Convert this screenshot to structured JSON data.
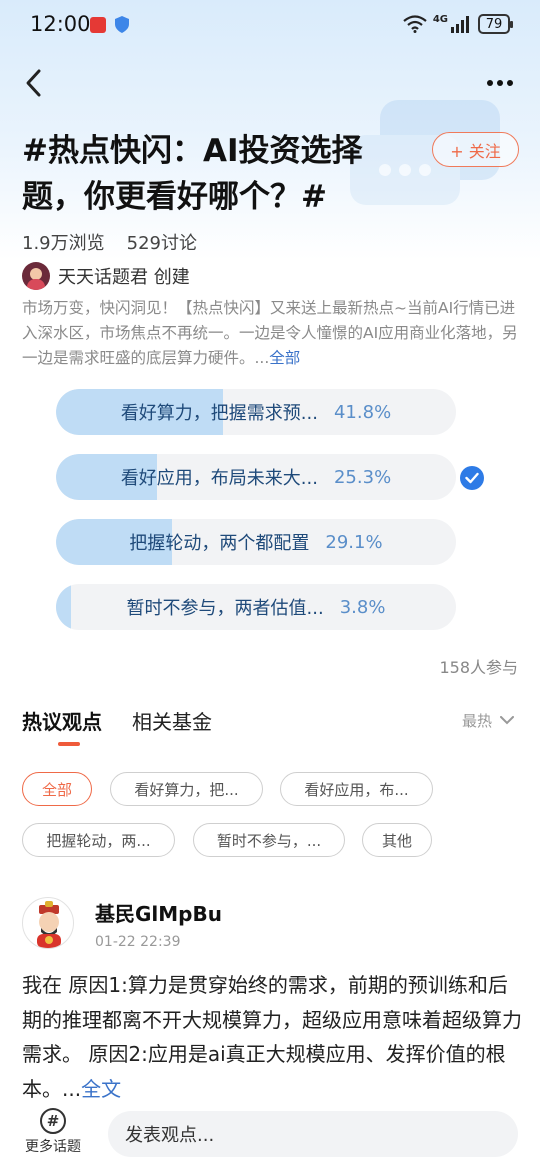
{
  "status_bar": {
    "time": "12:00",
    "network": "4G",
    "battery": "79"
  },
  "topic": {
    "title": "#热点快闪：AI投资选择题，你更看好哪个？#",
    "follow_label": "+ 关注",
    "views": "1.9万浏览",
    "discussions": "529讨论",
    "creator": "天天话题君 创建",
    "description": "市场万变，快闪洞见！【热点快闪】又来送上最新热点~当前AI行情已进入深水区，市场焦点不再统一。一边是令人憧憬的AI应用商业化落地，另一边是需求旺盛的底层算力硬件。...",
    "description_more": "全部"
  },
  "poll": {
    "options": [
      {
        "label": "看好算力，把握需求预...",
        "percent": "41.8%",
        "value": 41.8,
        "selected": false
      },
      {
        "label": "看好应用，布局未来大...",
        "percent": "25.3%",
        "value": 25.3,
        "selected": true
      },
      {
        "label": "把握轮动，两个都配置",
        "percent": "29.1%",
        "value": 29.1,
        "selected": false
      },
      {
        "label": "暂时不参与，两者估值...",
        "percent": "3.8%",
        "value": 3.8,
        "selected": false
      }
    ],
    "participants": "158人参与"
  },
  "tabs": {
    "active": "热议观点",
    "other": "相关基金",
    "sort": "最热"
  },
  "filters": [
    "全部",
    "看好算力，把...",
    "看好应用，布...",
    "把握轮动，两...",
    "暂时不参与，...",
    "其他"
  ],
  "post": {
    "user": "基民GlMpBu",
    "time": "01-22 22:39",
    "body": "我在 原因1:算力是贯穿始终的需求，前期的预训练和后期的推理都离不开大规模算力，超级应用意味着超级算力需求。 原因2:应用是ai真正大规模应用、发挥价值的根本。...",
    "more": "全文"
  },
  "bottom": {
    "more_topics": "更多话题",
    "topic_icon": "#",
    "input_placeholder": "发表观点..."
  },
  "colors": {
    "accent_orange": "#ef6a48",
    "poll_fill": "#bfdcf5",
    "link_blue": "#3b73c9",
    "check_blue": "#2e7be6"
  }
}
